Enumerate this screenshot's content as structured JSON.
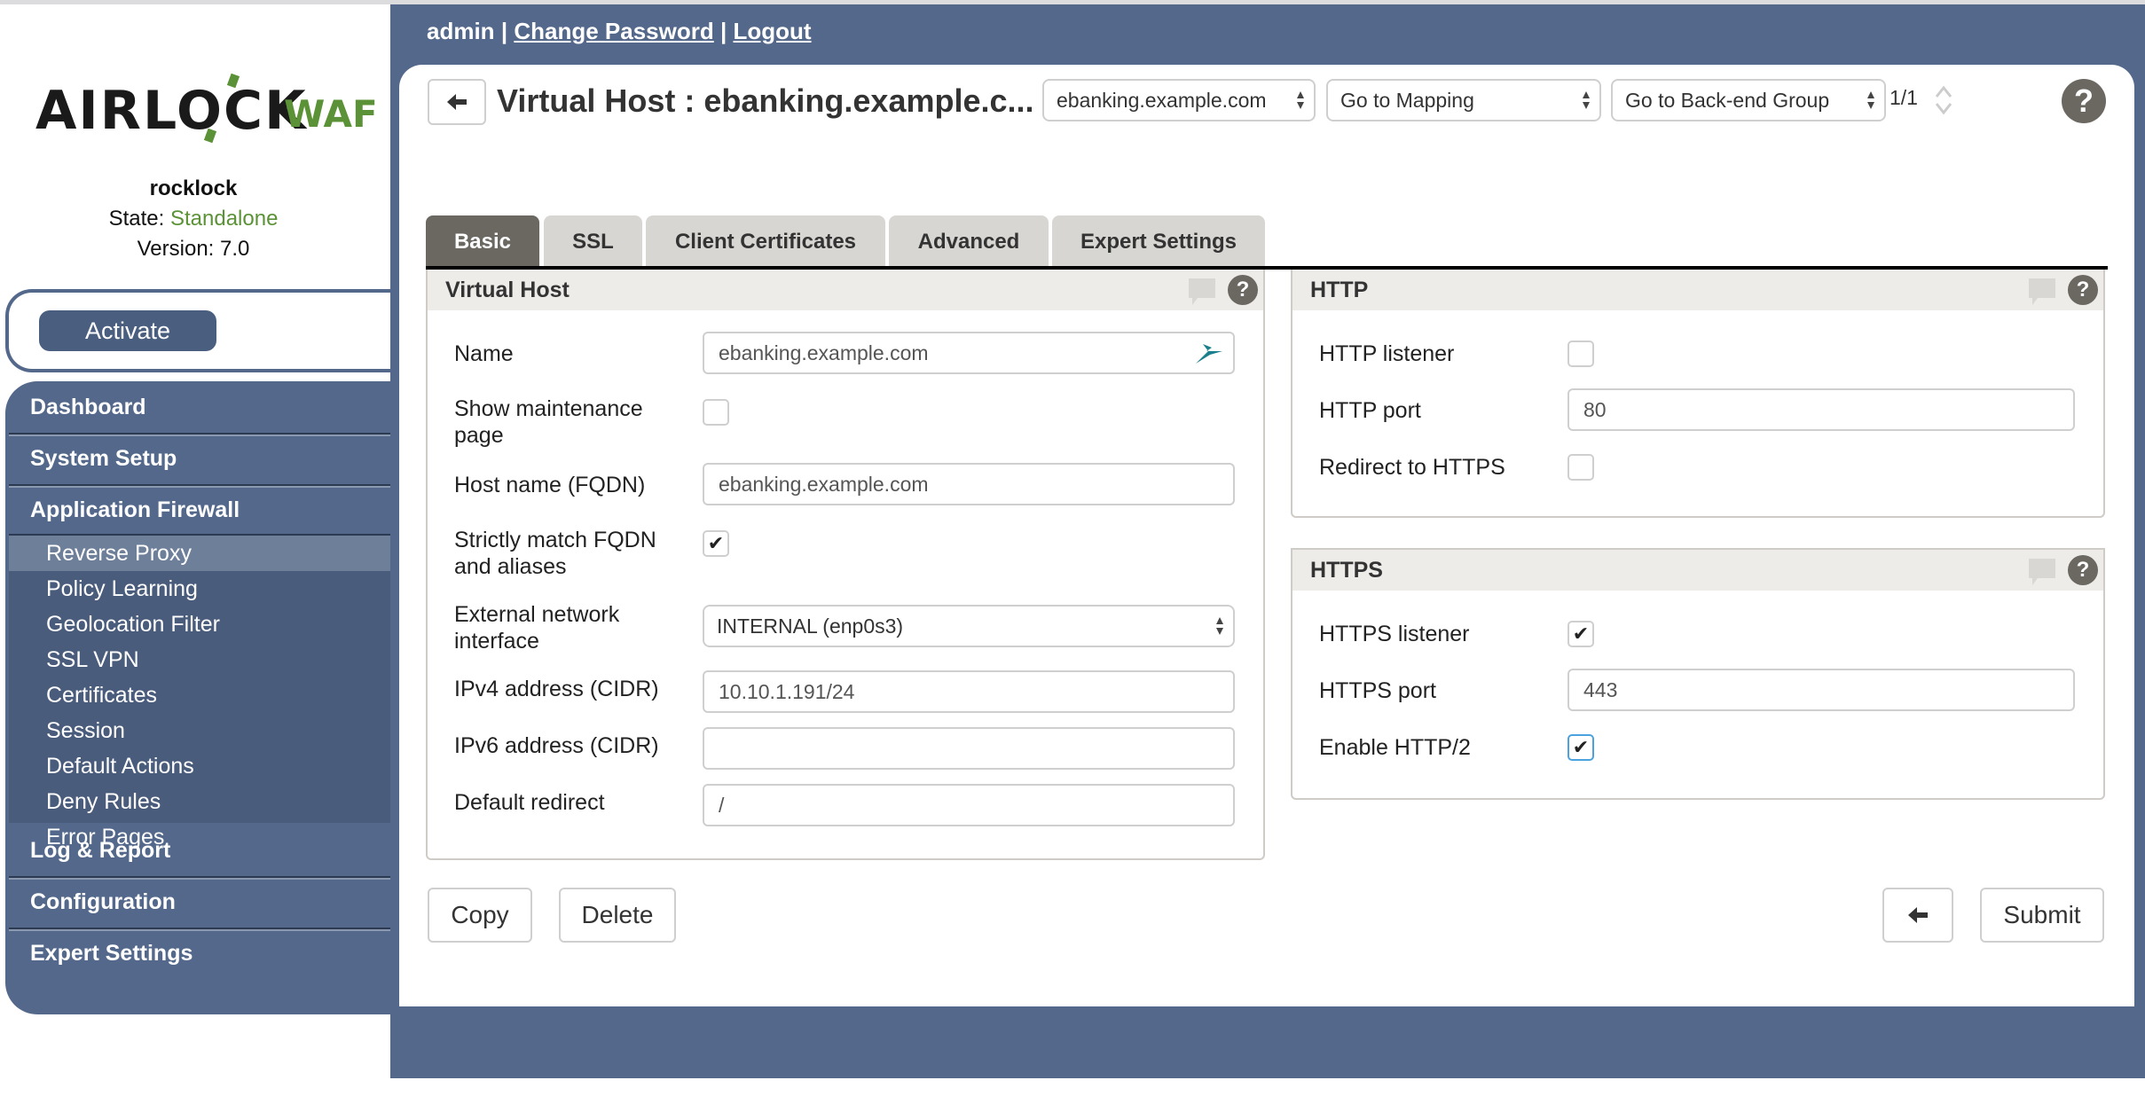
{
  "logo": {
    "name": "AIRLOCK",
    "product": "WAF"
  },
  "system": {
    "hostname": "rocklock",
    "state_label": "State:",
    "state_value": "Standalone",
    "version_label": "Version: 7.0"
  },
  "activate_label": "Activate",
  "nav": {
    "sections": [
      {
        "label": "Dashboard"
      },
      {
        "label": "System Setup"
      },
      {
        "label": "Application Firewall"
      },
      {
        "label": "Log & Report"
      },
      {
        "label": "Configuration"
      },
      {
        "label": "Expert Settings"
      }
    ],
    "sub_items": [
      {
        "label": "Reverse Proxy",
        "active": true
      },
      {
        "label": "Policy Learning"
      },
      {
        "label": "Geolocation Filter"
      },
      {
        "label": "SSL VPN"
      },
      {
        "label": "Certificates"
      },
      {
        "label": "Session"
      },
      {
        "label": "Default Actions"
      },
      {
        "label": "Deny Rules"
      },
      {
        "label": "Error Pages"
      }
    ]
  },
  "userbar": {
    "user": "admin",
    "sep": "|",
    "change_password": "Change Password",
    "logout": "Logout"
  },
  "header": {
    "title": "Virtual Host : ebanking.example.c...",
    "vhost_select": "ebanking.example.com",
    "mapping_select": "Go to Mapping",
    "backend_select": "Go to Back-end Group",
    "pager": "1/1"
  },
  "tabs": [
    {
      "label": "Basic",
      "active": true
    },
    {
      "label": "SSL"
    },
    {
      "label": "Client Certificates"
    },
    {
      "label": "Advanced"
    },
    {
      "label": "Expert Settings"
    }
  ],
  "vhost_panel": {
    "title": "Virtual Host",
    "fields": {
      "name": {
        "label": "Name",
        "value": "ebanking.example.com"
      },
      "maintenance": {
        "label1": "Show maintenance",
        "label2": "page",
        "checked": false
      },
      "fqdn": {
        "label": "Host name (FQDN)",
        "value": "ebanking.example.com"
      },
      "strict": {
        "label1": "Strictly match FQDN",
        "label2": "and aliases",
        "checked": true
      },
      "interface": {
        "label1": "External network",
        "label2": "interface",
        "value": "INTERNAL (enp0s3)"
      },
      "ipv4": {
        "label": "IPv4 address (CIDR)",
        "value": "10.10.1.191/24"
      },
      "ipv6": {
        "label": "IPv6 address (CIDR)",
        "value": ""
      },
      "redirect": {
        "label": "Default redirect",
        "value": "/"
      }
    }
  },
  "http_panel": {
    "title": "HTTP",
    "listener": {
      "label": "HTTP listener",
      "checked": false
    },
    "port": {
      "label": "HTTP port",
      "value": "80"
    },
    "redirect": {
      "label": "Redirect to HTTPS",
      "checked": false
    }
  },
  "https_panel": {
    "title": "HTTPS",
    "listener": {
      "label": "HTTPS listener",
      "checked": true
    },
    "port": {
      "label": "HTTPS port",
      "value": "443"
    },
    "http2": {
      "label": "Enable HTTP/2",
      "checked": true
    }
  },
  "actions": {
    "copy": "Copy",
    "delete": "Delete",
    "submit": "Submit"
  },
  "check_glyph": "✔",
  "colors": {
    "nav_bg": "#53688a",
    "accent_green": "#5c9237",
    "active_tab": "#6b6862"
  }
}
